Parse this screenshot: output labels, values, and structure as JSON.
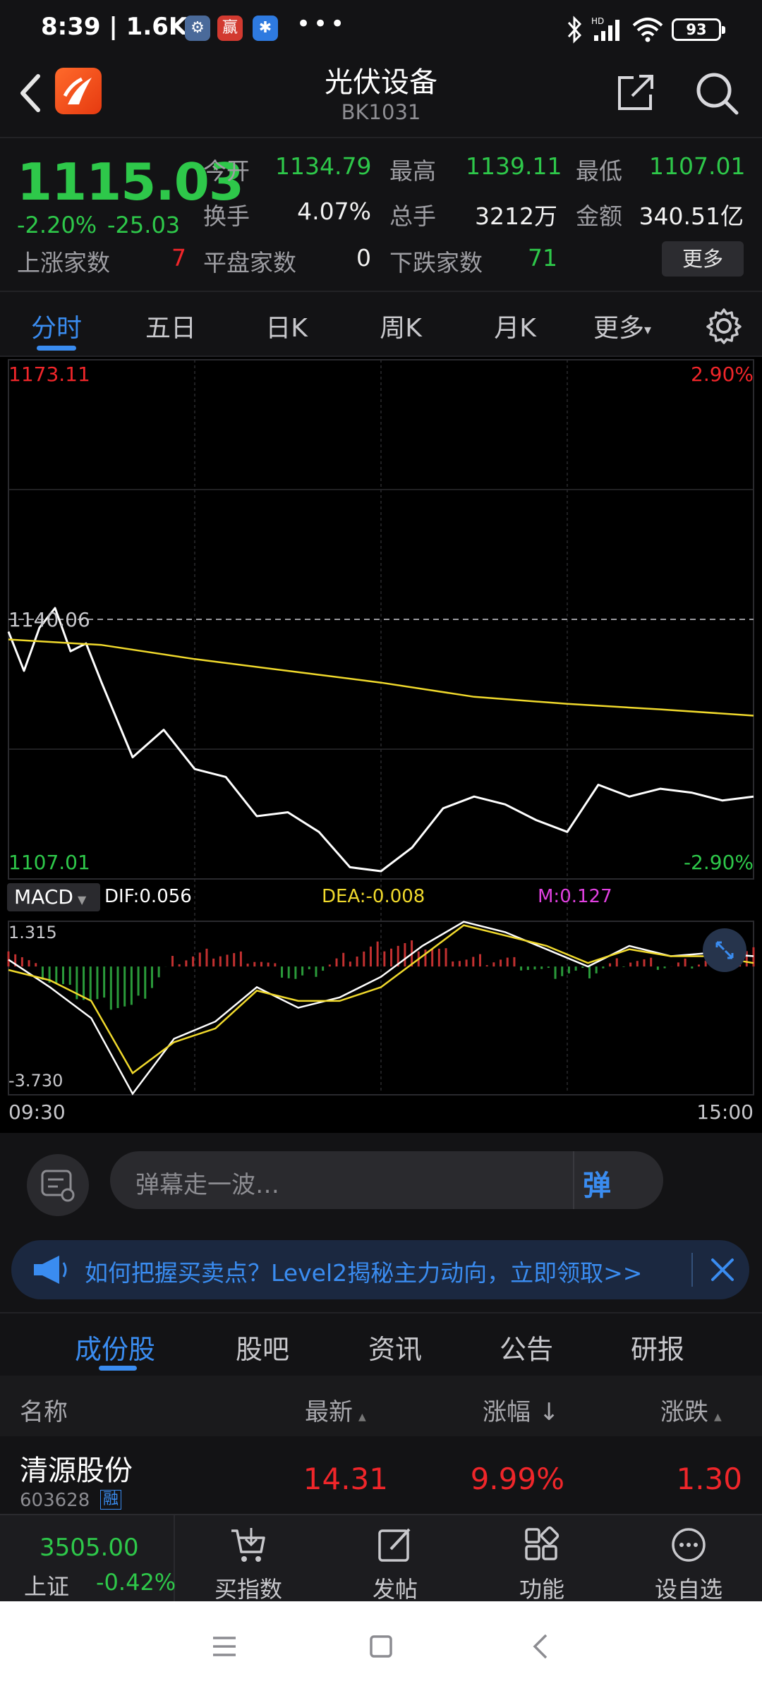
{
  "status_bar": {
    "time": "8:39 | 1.6K/s",
    "battery": "93"
  },
  "header": {
    "title": "光伏设备",
    "code": "BK1031"
  },
  "quote": {
    "price": "1115.03",
    "change_pct": "-2.20%",
    "change": "-25.03",
    "open_label": "今开",
    "open": "1134.79",
    "high_label": "最高",
    "high": "1139.11",
    "low_label": "最低",
    "low": "1107.01",
    "turnover_label": "换手",
    "turnover": "4.07%",
    "volume_label": "总手",
    "volume": "3212万",
    "amount_label": "金额",
    "amount": "340.51亿",
    "up_label": "上涨家数",
    "up": "7",
    "flat_label": "平盘家数",
    "flat": "0",
    "down_label": "下跌家数",
    "down": "71",
    "more_button": "更多"
  },
  "tabs": [
    "分时",
    "五日",
    "日K",
    "周K",
    "月K",
    "更多"
  ],
  "chart": {
    "y_max": "1173.11",
    "y_mid": "1140.06",
    "y_min": "1107.01",
    "pct_max": "2.90%",
    "pct_min": "-2.90%",
    "indicator": "MACD",
    "dif": "DIF:0.056",
    "dea": "DEA:-0.008",
    "m": "M:0.127",
    "macd_max": "1.315",
    "macd_min": "-3.730",
    "time_start": "09:30",
    "time_end": "15:00"
  },
  "chart_data": {
    "type": "line",
    "xlabel": "",
    "ylabel": "",
    "xlim": [
      "09:30",
      "15:00"
    ],
    "ylim": [
      1107.01,
      1173.11
    ],
    "series": [
      {
        "name": "price",
        "color": "#ffffff",
        "x": [
          "09:30",
          "09:35",
          "09:40",
          "09:45",
          "09:50",
          "09:55",
          "10:00",
          "10:10",
          "10:20",
          "10:30",
          "10:40",
          "10:50",
          "11:00",
          "11:10",
          "11:20",
          "11:30",
          "13:10",
          "13:20",
          "13:30",
          "13:40",
          "13:50",
          "14:00",
          "14:10",
          "14:20",
          "14:30",
          "14:40",
          "14:50",
          "15:00"
        ],
        "values": [
          1138.5,
          1133.5,
          1139.0,
          1141.5,
          1136.0,
          1137.0,
          1132.0,
          1122.5,
          1126.0,
          1121.0,
          1120.0,
          1115.0,
          1115.5,
          1113.0,
          1108.5,
          1108.0,
          1111.0,
          1116.0,
          1117.5,
          1116.5,
          1114.5,
          1113.0,
          1119.0,
          1117.5,
          1118.5,
          1118.0,
          1117.0,
          1117.5
        ]
      },
      {
        "name": "avg",
        "color": "#f0d92c",
        "x": [
          "09:30",
          "10:00",
          "10:30",
          "11:00",
          "11:30",
          "13:30",
          "14:00",
          "14:30",
          "15:00"
        ],
        "values": [
          1137.5,
          1136.8,
          1135.0,
          1133.5,
          1132.0,
          1130.2,
          1129.3,
          1128.6,
          1127.8
        ]
      }
    ],
    "macd": {
      "dif": [
        0.2,
        -0.6,
        -1.5,
        -3.7,
        -2.1,
        -1.6,
        -0.6,
        -1.2,
        -0.9,
        -0.3,
        0.6,
        1.3,
        1.0,
        0.5,
        0.0,
        0.6,
        0.3,
        0.4,
        0.3
      ],
      "dea": [
        -0.1,
        -0.4,
        -1.0,
        -3.1,
        -2.2,
        -1.8,
        -0.7,
        -1.0,
        -1.0,
        -0.6,
        0.3,
        1.2,
        0.9,
        0.6,
        0.1,
        0.5,
        0.3,
        0.3,
        0.1
      ]
    }
  },
  "danmaku": {
    "placeholder": "弹幕走一波…",
    "button": "弹"
  },
  "banner": {
    "text": "如何把握买卖点？Level2揭秘主力动向，立即领取>>"
  },
  "sub_tabs": [
    "成份股",
    "股吧",
    "资讯",
    "公告",
    "研报"
  ],
  "table": {
    "headers": [
      "名称",
      "最新",
      "涨幅",
      "涨跌"
    ],
    "rows": [
      {
        "name": "清源股份",
        "code": "603628",
        "tag": "融",
        "last": "14.31",
        "pct": "9.99%",
        "change": "1.30"
      }
    ]
  },
  "bottom_bar": {
    "index_value": "3505.00",
    "index_name": "上证",
    "index_pct": "-0.42%",
    "items": [
      "买指数",
      "发帖",
      "功能",
      "设自选"
    ]
  }
}
